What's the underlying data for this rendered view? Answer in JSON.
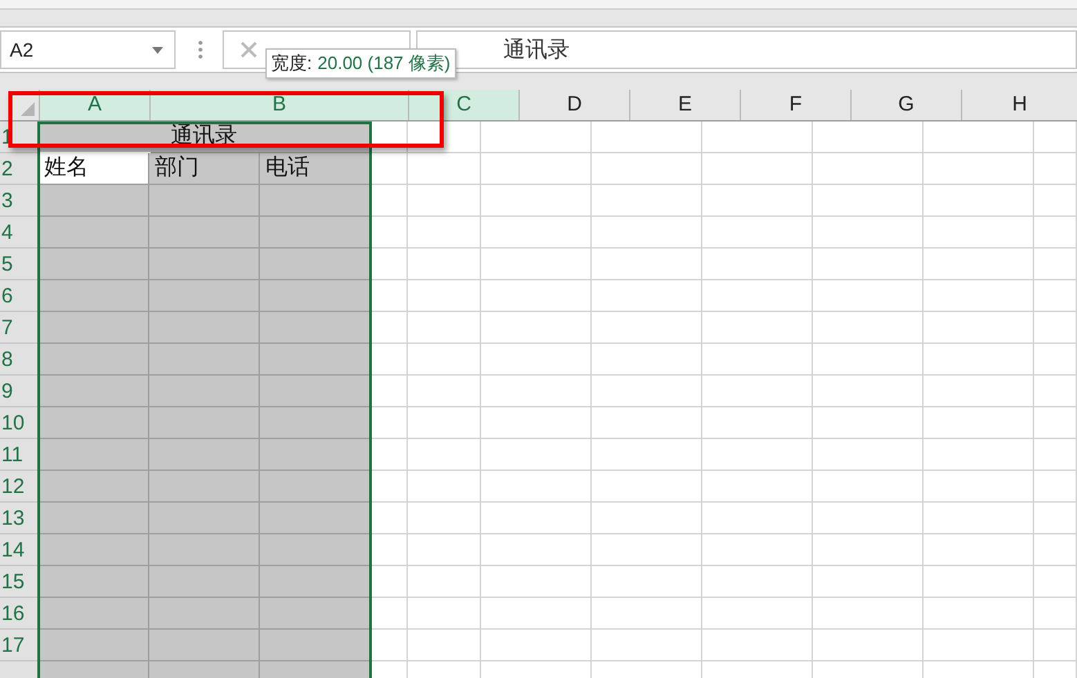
{
  "name_box": {
    "value": "A2"
  },
  "formula_bar": {
    "value": "通讯录"
  },
  "tooltip": {
    "label": "宽度:",
    "value": "20.00 (187 像素)"
  },
  "columns": [
    {
      "label": "A",
      "selected": true
    },
    {
      "label": "B",
      "selected": true
    },
    {
      "label": "C",
      "selected": true
    },
    {
      "label": "D",
      "selected": false
    },
    {
      "label": "E",
      "selected": false
    },
    {
      "label": "F",
      "selected": false
    },
    {
      "label": "G",
      "selected": false
    },
    {
      "label": "H",
      "selected": false
    }
  ],
  "rows": [
    {
      "number": "1",
      "cells": [
        {
          "text": "通讯录",
          "kind": "merged"
        }
      ]
    },
    {
      "number": "2",
      "cells": [
        {
          "text": "姓名",
          "kind": "plain",
          "active": true
        },
        {
          "text": "部门",
          "kind": "plain",
          "active": false
        },
        {
          "text": "电话",
          "kind": "plain",
          "active": false
        }
      ]
    },
    {
      "number": "3"
    },
    {
      "number": "4"
    },
    {
      "number": "5"
    },
    {
      "number": "6"
    },
    {
      "number": "7"
    },
    {
      "number": "8"
    },
    {
      "number": "9"
    },
    {
      "number": "10"
    },
    {
      "number": "11"
    },
    {
      "number": "12"
    },
    {
      "number": "13"
    },
    {
      "number": "14"
    },
    {
      "number": "15"
    },
    {
      "number": "16"
    },
    {
      "number": "17"
    }
  ]
}
